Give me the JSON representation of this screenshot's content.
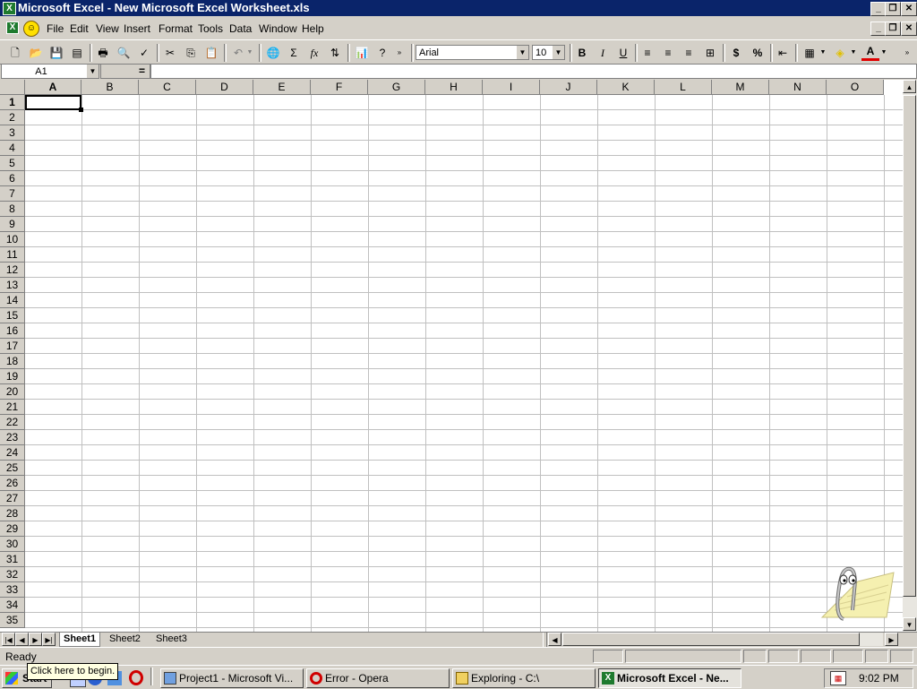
{
  "window": {
    "title": "Microsoft Excel - New Microsoft Excel Worksheet.xls"
  },
  "menu": [
    "File",
    "Edit",
    "View",
    "Insert",
    "Format",
    "Tools",
    "Data",
    "Window",
    "Help"
  ],
  "toolbar": {
    "font_name": "Arial",
    "font_size": "10",
    "bold_label": "B",
    "italic_label": "I",
    "underline_label": "U",
    "currency_label": "$",
    "percent_label": "%",
    "sum_label": "Σ",
    "function_label": "fx"
  },
  "formula_bar": {
    "name_box": "A1",
    "equals": "="
  },
  "grid": {
    "columns": [
      "A",
      "B",
      "C",
      "D",
      "E",
      "F",
      "G",
      "H",
      "I",
      "J",
      "K",
      "L",
      "M",
      "N",
      "O"
    ],
    "rows": [
      "1",
      "2",
      "3",
      "4",
      "5",
      "6",
      "7",
      "8",
      "9",
      "10",
      "11",
      "12",
      "13",
      "14",
      "15",
      "16",
      "17",
      "18",
      "19",
      "20",
      "21",
      "22",
      "23",
      "24",
      "25",
      "26",
      "27",
      "28",
      "29",
      "30",
      "31",
      "32",
      "33",
      "34",
      "35"
    ],
    "selected_cell": "A1"
  },
  "sheet_tabs": [
    "Sheet1",
    "Sheet2",
    "Sheet3"
  ],
  "active_sheet": "Sheet1",
  "status": {
    "text": "Ready"
  },
  "taskbar": {
    "start": "Start",
    "tooltip": "Click here to begin.",
    "tasks": [
      {
        "label": "Project1 - Microsoft Vi...",
        "icon": "vb-icon"
      },
      {
        "label": "Error - Opera",
        "icon": "opera-icon"
      },
      {
        "label": "Exploring - C:\\",
        "icon": "explorer-icon"
      },
      {
        "label": "Microsoft Excel - Ne...",
        "icon": "excel-icon",
        "active": true
      }
    ],
    "clock": "9:02 PM"
  },
  "colors": {
    "titlebar": "#0a246a",
    "chrome": "#d4d0c8",
    "gridline": "#c0c0c0"
  }
}
